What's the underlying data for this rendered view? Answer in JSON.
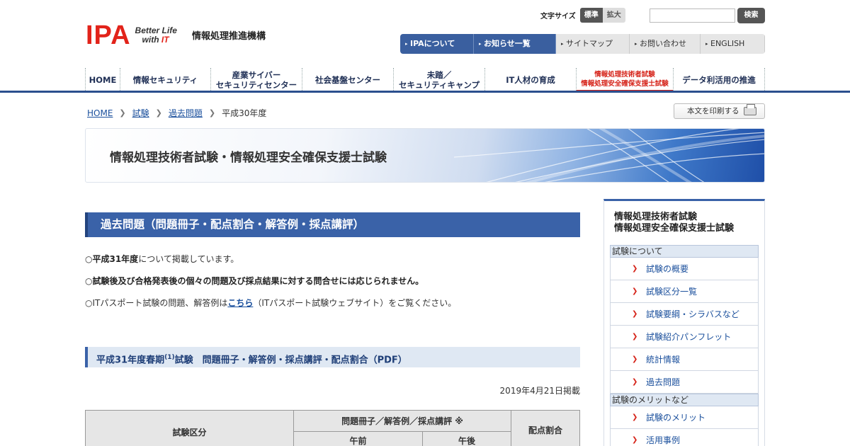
{
  "header": {
    "logo_text": "IPA",
    "logo_tagline_1": "Better Life",
    "logo_tagline_2a": "with ",
    "logo_tagline_2b": "IT",
    "org_name": "情報処理推進機構",
    "font_size_label": "文字サイズ",
    "font_size_standard": "標準",
    "font_size_large": "拡大",
    "search_placeholder": "",
    "search_button": "検索"
  },
  "util_nav": [
    "IPAについて",
    "お知らせ一覧",
    "サイトマップ",
    "お問い合わせ",
    "ENGLISH"
  ],
  "global_nav": [
    {
      "line1": "HOME",
      "line2": ""
    },
    {
      "line1": "情報セキュリティ",
      "line2": ""
    },
    {
      "line1": "産業サイバー",
      "line2": "セキュリティセンター"
    },
    {
      "line1": "社会基盤センター",
      "line2": ""
    },
    {
      "line1": "未踏／",
      "line2": "セキュリティキャンプ"
    },
    {
      "line1": "IT人材の育成",
      "line2": ""
    },
    {
      "line1": "情報処理技術者試験",
      "line2": "情報処理安全確保支援士試験"
    },
    {
      "line1": "データ利活用の推進",
      "line2": ""
    }
  ],
  "breadcrumb": {
    "items": [
      "HOME",
      "試験",
      "過去問題"
    ],
    "current": "平成30年度"
  },
  "print_button": "本文を印刷する",
  "banner_title": "情報処理技術者試験・情報処理安全確保支援士試験",
  "main": {
    "heading": "過去問題（問題冊子・配点割合・解答例・採点講評）",
    "p1_bold": "平成31年度",
    "p1_rest": "について掲載しています。",
    "p2": "試験後及び合格発表後の個々の問題及び採点結果に対する問合せには応じられません。",
    "p3_pre": "ITパスポート試験の問題、解答例は",
    "p3_link": "こちら",
    "p3_post": "（ITパスポート試験ウェブサイト）をご覧ください。",
    "bullet": "○",
    "section_heading_pre": "平成31年度春期",
    "section_heading_sup": "(1)",
    "section_heading_post": "試験　問題冊子・解答例・採点講評・配点割合（PDF）",
    "posted_date": "2019年4月21日掲載",
    "table": {
      "col_category": "試験区分",
      "col_booklet": "問題冊子／解答例／採点講評 ※",
      "col_am": "午前",
      "col_pm": "午後",
      "col_ratio": "配点割合"
    }
  },
  "sidebar": {
    "title_1": "情報処理技術者試験",
    "title_2": "情報処理安全確保支援士試験",
    "categories": [
      {
        "label": "試験について",
        "links": [
          "試験の概要",
          "試験区分一覧",
          "試験要綱・シラバスなど",
          "試験紹介パンフレット",
          "統計情報",
          "過去問題"
        ]
      },
      {
        "label": "試験のメリットなど",
        "links": [
          "試験のメリット",
          "活用事例"
        ]
      }
    ]
  },
  "colors": {
    "primary_blue": "#3a62a8",
    "accent_red": "#e2231a"
  }
}
